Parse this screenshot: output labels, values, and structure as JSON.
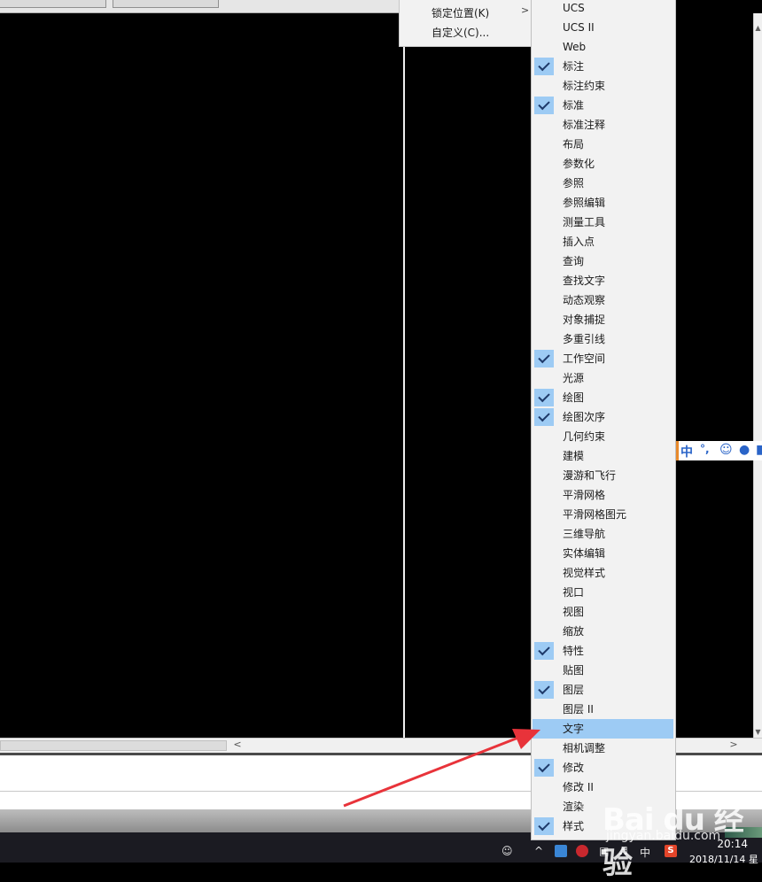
{
  "parent_menu": {
    "items": [
      {
        "label": "锁定位置(K)",
        "has_submenu": true
      },
      {
        "label": "自定义(C)..."
      }
    ]
  },
  "toolbar_menu": {
    "items": [
      {
        "label": "UCS",
        "checked": false
      },
      {
        "label": "UCS II",
        "checked": false
      },
      {
        "label": "Web",
        "checked": false
      },
      {
        "label": "标注",
        "checked": true
      },
      {
        "label": "标注约束",
        "checked": false
      },
      {
        "label": "标准",
        "checked": true
      },
      {
        "label": "标准注释",
        "checked": false
      },
      {
        "label": "布局",
        "checked": false
      },
      {
        "label": "参数化",
        "checked": false
      },
      {
        "label": "参照",
        "checked": false
      },
      {
        "label": "参照编辑",
        "checked": false
      },
      {
        "label": "测量工具",
        "checked": false
      },
      {
        "label": "插入点",
        "checked": false
      },
      {
        "label": "查询",
        "checked": false
      },
      {
        "label": "查找文字",
        "checked": false
      },
      {
        "label": "动态观察",
        "checked": false
      },
      {
        "label": "对象捕捉",
        "checked": false
      },
      {
        "label": "多重引线",
        "checked": false
      },
      {
        "label": "工作空间",
        "checked": true
      },
      {
        "label": "光源",
        "checked": false
      },
      {
        "label": "绘图",
        "checked": true
      },
      {
        "label": "绘图次序",
        "checked": true
      },
      {
        "label": "几何约束",
        "checked": false
      },
      {
        "label": "建模",
        "checked": false
      },
      {
        "label": "漫游和飞行",
        "checked": false
      },
      {
        "label": "平滑网格",
        "checked": false
      },
      {
        "label": "平滑网格图元",
        "checked": false
      },
      {
        "label": "三维导航",
        "checked": false
      },
      {
        "label": "实体编辑",
        "checked": false
      },
      {
        "label": "视觉样式",
        "checked": false
      },
      {
        "label": "视口",
        "checked": false
      },
      {
        "label": "视图",
        "checked": false
      },
      {
        "label": "缩放",
        "checked": false
      },
      {
        "label": "特性",
        "checked": true
      },
      {
        "label": "贴图",
        "checked": false
      },
      {
        "label": "图层",
        "checked": true
      },
      {
        "label": "图层 II",
        "checked": false
      },
      {
        "label": "文字",
        "checked": false,
        "highlighted": true
      },
      {
        "label": "相机调整",
        "checked": false
      },
      {
        "label": "修改",
        "checked": true
      },
      {
        "label": "修改 II",
        "checked": false
      },
      {
        "label": "渲染",
        "checked": false
      },
      {
        "label": "样式",
        "checked": true
      }
    ]
  },
  "ime_bar": {
    "mode": "中",
    "punct": "°,",
    "emoji_icon": "smiley-icon",
    "voice_icon": "microphone-icon"
  },
  "taskbar": {
    "ime_indicator": "中",
    "sogou_glyph": "S",
    "time": "20:14",
    "date": "2018/11/14 星"
  },
  "watermark": {
    "brand": "Bai du 经验",
    "url": "jingyan.baidu.com"
  },
  "colors": {
    "menu_bg": "#f2f2f2",
    "check_highlight": "#9dcbf4",
    "canvas_bg": "#000000",
    "arrow": "#e8333a"
  }
}
